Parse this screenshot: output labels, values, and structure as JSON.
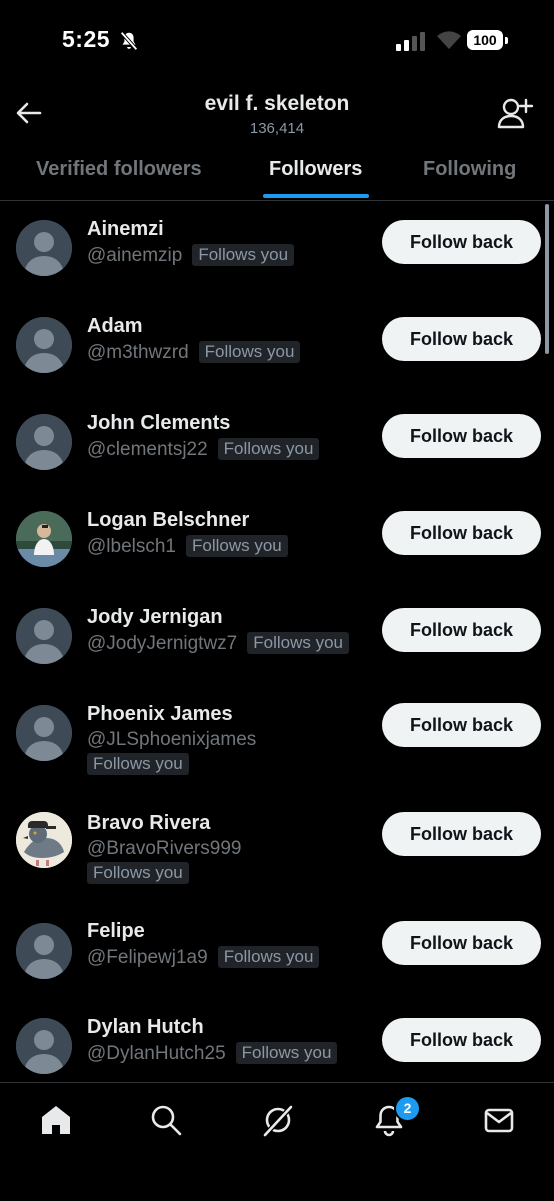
{
  "status_bar": {
    "time": "5:25",
    "battery": "100"
  },
  "header": {
    "title": "evil f. skeleton",
    "count": "136,414"
  },
  "tabs": [
    {
      "label": "Verified followers",
      "active": false
    },
    {
      "label": "Followers",
      "active": true
    },
    {
      "label": "Following",
      "active": false
    }
  ],
  "follow_label": "Follow back",
  "follows_you_label": "Follows you",
  "followers": [
    {
      "name": "Ainemzi",
      "handle": "@ainemzip"
    },
    {
      "name": "Adam",
      "handle": "@m3thwzrd"
    },
    {
      "name": "John Clements",
      "handle": "@clementsj22"
    },
    {
      "name": "Logan Belschner",
      "handle": "@lbelsch1"
    },
    {
      "name": "Jody Jernigan",
      "handle": "@JodyJernigtwz7"
    },
    {
      "name": "Phoenix James",
      "handle": "@JLSphoenixjames"
    },
    {
      "name": "Bravo Rivera",
      "handle": "@BravoRivers999"
    },
    {
      "name": "Felipe",
      "handle": "@Felipewj1a9"
    },
    {
      "name": "Dylan Hutch",
      "handle": "@DylanHutch25"
    }
  ],
  "bottom_nav": {
    "items": [
      "home-icon",
      "search-icon",
      "grok-icon",
      "notifications-icon",
      "messages-icon"
    ],
    "notifications_count": "2"
  },
  "colors": {
    "accent": "#1d9bf0",
    "background": "#000000",
    "button": "#eff3f4"
  }
}
